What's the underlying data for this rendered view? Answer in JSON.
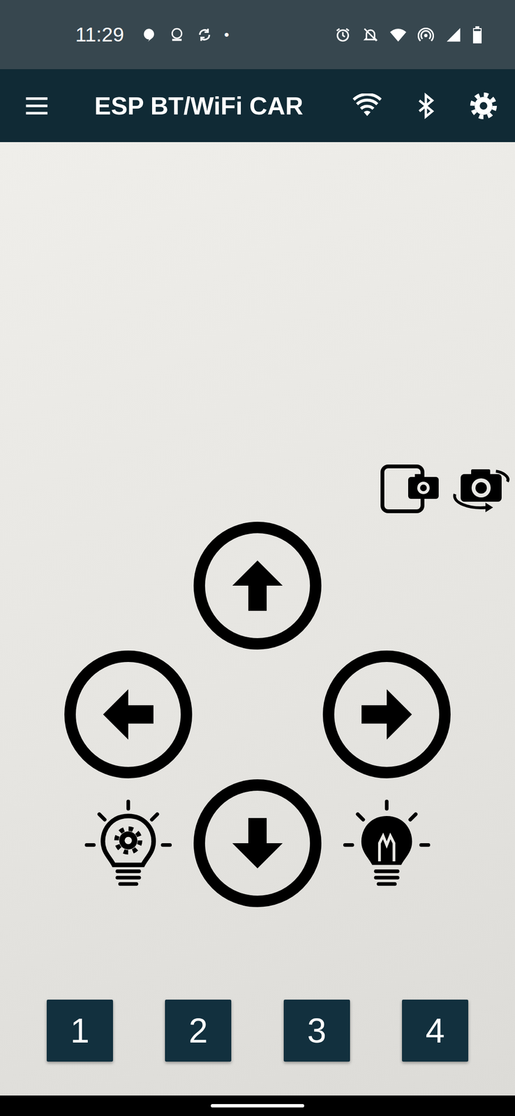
{
  "status_bar": {
    "time": "11:29",
    "more_notifications": "•",
    "battery": {
      "level": 0.85
    }
  },
  "app_bar": {
    "title": "ESP BT/WiFi CAR"
  },
  "aux_buttons": [
    {
      "label": "1"
    },
    {
      "label": "2"
    },
    {
      "label": "3"
    },
    {
      "label": "4"
    }
  ]
}
